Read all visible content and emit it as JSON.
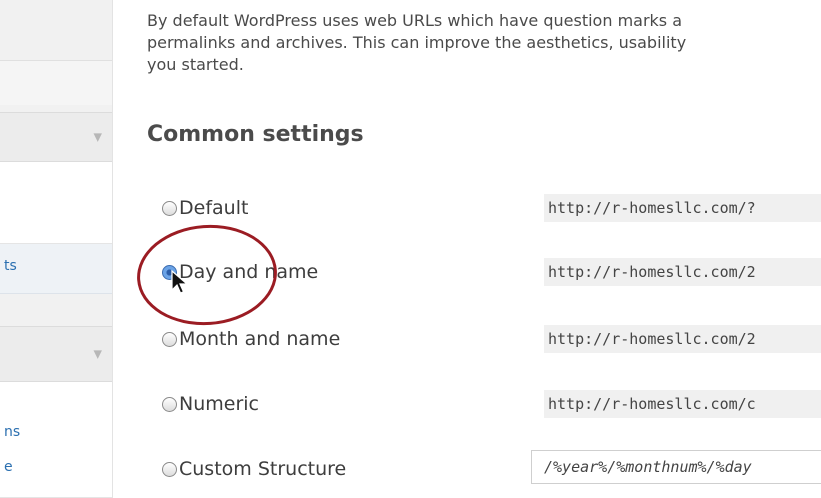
{
  "sidebar": {
    "fragments": [
      "ts",
      "ns",
      "e"
    ]
  },
  "intro": {
    "line1": "By default WordPress uses web URLs which have question marks a",
    "line2": "permalinks and archives. This can improve the aesthetics, usability",
    "line3": "you started."
  },
  "section": {
    "heading": "Common settings"
  },
  "options": [
    {
      "label": "Default",
      "url": "http://r-homesllc.com/?",
      "checked": false
    },
    {
      "label": "Day and name",
      "url": "http://r-homesllc.com/2",
      "checked": true
    },
    {
      "label": "Month and name",
      "url": "http://r-homesllc.com/2",
      "checked": false
    },
    {
      "label": "Numeric",
      "url": "http://r-homesllc.com/c",
      "checked": false
    },
    {
      "label": "Custom Structure",
      "value": "/%year%/%monthnum%/%day",
      "checked": false
    }
  ],
  "colors": {
    "link": "#2a6fb0",
    "annotation_circle": "#9b1c23",
    "radio_selected": "#2c5ea8"
  },
  "icons": {
    "sidebar_arrow": "triangle-down-icon",
    "pointer": "mouse-pointer-icon"
  }
}
